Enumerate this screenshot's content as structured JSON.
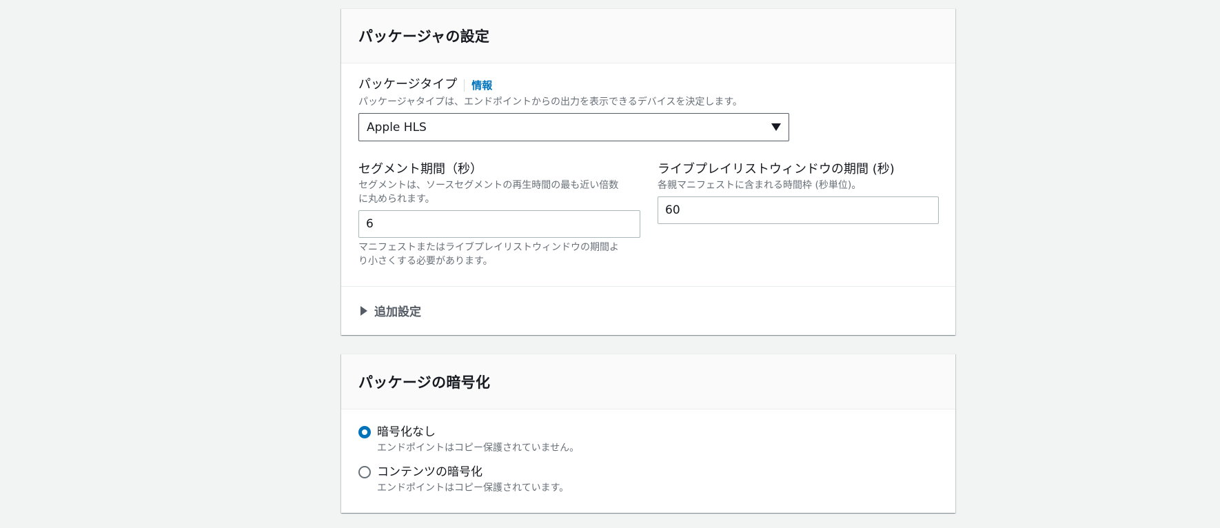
{
  "packager_settings": {
    "title": "パッケージャの設定",
    "package_type": {
      "label": "パッケージタイプ",
      "info_link": "情報",
      "description": "パッケージャタイプは、エンドポイントからの出力を表示できるデバイスを決定します。",
      "selected_value": "Apple HLS"
    },
    "segment_duration": {
      "label": "セグメント期間（秒）",
      "description_line1": "セグメントは、ソースセグメントの再生時間の最も近い倍数",
      "description_line2": "に丸められます。",
      "value": "6",
      "hint_line1": "マニフェストまたはライブプレイリストウィンドウの期間よ",
      "hint_line2": "り小さくする必要があります。"
    },
    "live_playlist_window": {
      "label": "ライブプレイリストウィンドウの期間 (秒)",
      "description": "各親マニフェストに含まれる時間枠 (秒単位)。",
      "value": "60"
    },
    "additional_settings": {
      "label": "追加設定"
    }
  },
  "package_encryption": {
    "title": "パッケージの暗号化",
    "options": [
      {
        "label": "暗号化なし",
        "description": "エンドポイントはコピー保護されていません。",
        "selected": true
      },
      {
        "label": "コンテンツの暗号化",
        "description": "エンドポイントはコピー保護されています。",
        "selected": false
      }
    ]
  },
  "colors": {
    "page_background": "#f2f3f3",
    "link": "#0073bb",
    "radio_selected": "#0073bb",
    "text_primary": "#16191f",
    "text_secondary": "#687078"
  },
  "icons": {
    "select_caret": "caret-down-icon",
    "expander": "caret-right-icon"
  }
}
